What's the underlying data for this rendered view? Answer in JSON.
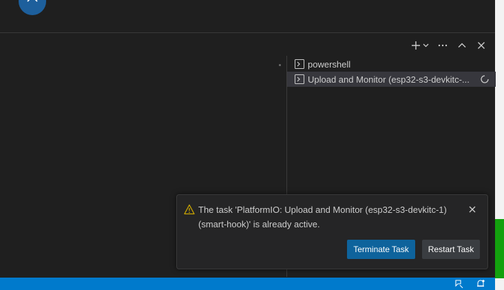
{
  "colors": {
    "accent": "#007acc",
    "primary_button": "#0e639c",
    "warning": "#cca700"
  },
  "panel_toolbar": {
    "icons": [
      "add-icon",
      "chevron-down-icon",
      "more-icon",
      "chevron-up-icon",
      "close-icon"
    ]
  },
  "terminals": [
    {
      "label": "powershell",
      "icon": "terminal-icon",
      "selected": false
    },
    {
      "label": "Upload and Monitor (esp32-s3-devkitc-...",
      "icon": "terminal-icon",
      "selected": true,
      "busy": true
    }
  ],
  "notification": {
    "icon": "warning-icon",
    "message": "The task 'PlatformIO: Upload and Monitor (esp32-s3-devkitc-1) (smart-hook)' is already active.",
    "primary_action": "Terminate Task",
    "secondary_action": "Restart Task"
  },
  "statusbar": {
    "icons": [
      "feedback-icon",
      "notifications-icon"
    ]
  }
}
